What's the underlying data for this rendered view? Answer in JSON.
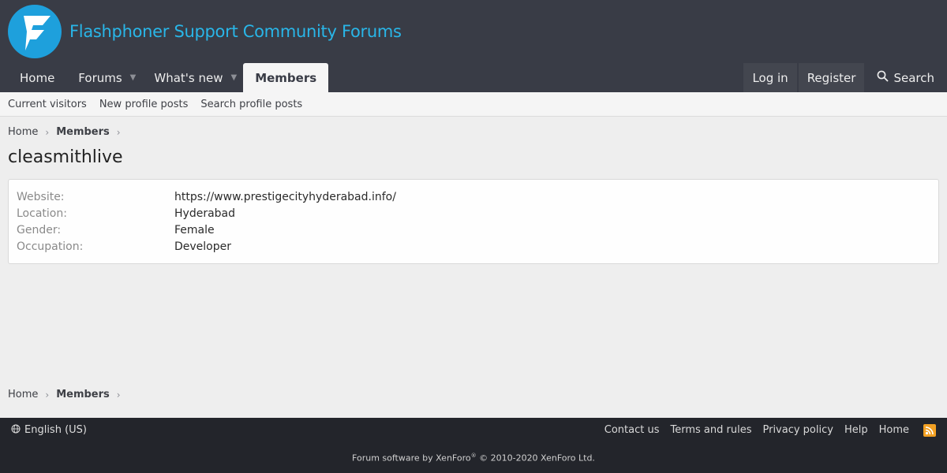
{
  "header": {
    "site_title": "Flashphoner Support Community Forums",
    "colors": {
      "header_bg": "#393c46",
      "accent": "#29b6e8"
    },
    "nav": {
      "home": "Home",
      "forums": "Forums",
      "whats_new": "What's new",
      "members": "Members",
      "caret_icon": "chevron-down-icon"
    },
    "account": {
      "login": "Log in",
      "register": "Register",
      "search": "Search"
    }
  },
  "subnav": {
    "items": [
      "Current visitors",
      "New profile posts",
      "Search profile posts"
    ]
  },
  "breadcrumb": {
    "home": "Home",
    "members": "Members"
  },
  "profile": {
    "username": "cleasmithlive",
    "fields": [
      {
        "label": "Website:",
        "value": "https://www.prestigecityhyderabad.info/"
      },
      {
        "label": "Location:",
        "value": "Hyderabad"
      },
      {
        "label": "Gender:",
        "value": "Female"
      },
      {
        "label": "Occupation:",
        "value": "Developer"
      }
    ]
  },
  "footer": {
    "language": "English (US)",
    "links": [
      "Contact us",
      "Terms and rules",
      "Privacy policy",
      "Help",
      "Home"
    ],
    "copyright_prefix": "Forum software by XenForo",
    "copyright_mark": "®",
    "copyright_suffix": " © 2010-2020 XenForo Ltd."
  }
}
